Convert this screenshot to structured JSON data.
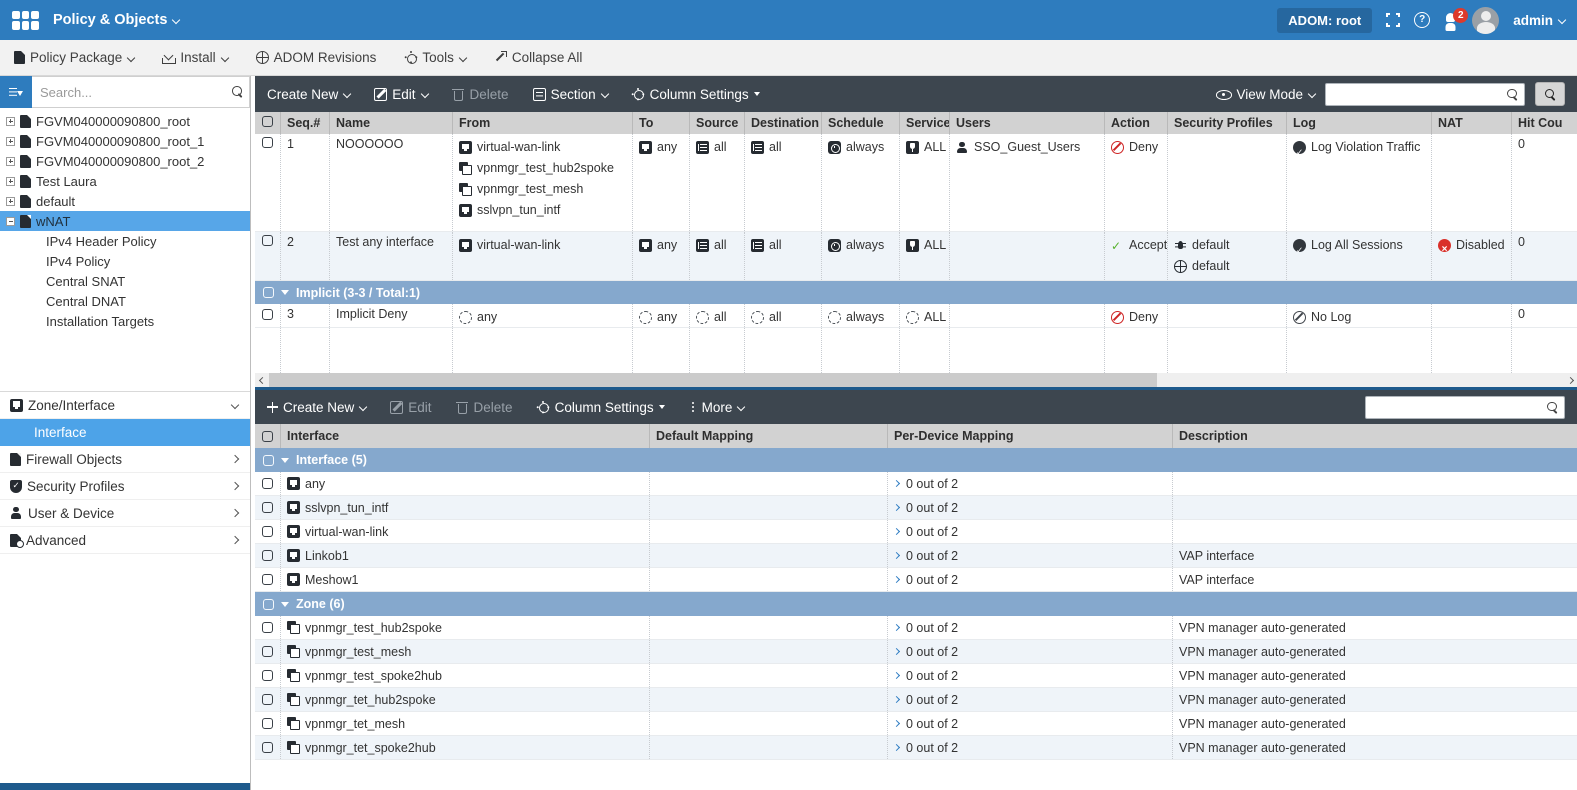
{
  "topbar": {
    "title": "Policy & Objects",
    "adom_label": "ADOM: root",
    "notification_count": "2",
    "username": "admin"
  },
  "menubar": {
    "policy_package": "Policy Package",
    "install": "Install",
    "adom_revisions": "ADOM Revisions",
    "tools": "Tools",
    "collapse_all": "Collapse All"
  },
  "sidebar": {
    "search_placeholder": "Search...",
    "tree": [
      {
        "label": "FGVM040000090800_root"
      },
      {
        "label": "FGVM040000090800_root_1"
      },
      {
        "label": "FGVM040000090800_root_2"
      },
      {
        "label": "Test Laura"
      },
      {
        "label": "default"
      },
      {
        "label": "wNAT"
      }
    ],
    "tree_children": [
      {
        "label": "IPv4 Header Policy"
      },
      {
        "label": "IPv4 Policy"
      },
      {
        "label": "Central SNAT"
      },
      {
        "label": "Central DNAT"
      },
      {
        "label": "Installation Targets"
      }
    ],
    "nav": [
      {
        "label": "Zone/Interface"
      },
      {
        "label": "Interface"
      },
      {
        "label": "Firewall Objects"
      },
      {
        "label": "Security Profiles"
      },
      {
        "label": "User & Device"
      },
      {
        "label": "Advanced"
      }
    ]
  },
  "policy_panel": {
    "toolbar": {
      "create_new": "Create New",
      "edit": "Edit",
      "delete": "Delete",
      "section": "Section",
      "column_settings": "Column Settings",
      "view_mode": "View Mode"
    },
    "columns": [
      "Seq.#",
      "Name",
      "From",
      "To",
      "Source",
      "Destination",
      "Schedule",
      "Service",
      "Users",
      "Action",
      "Security Profiles",
      "Log",
      "NAT",
      "Hit Cou"
    ],
    "rows": [
      {
        "seq": "1",
        "name": "NOOOOOO",
        "from": [
          {
            "icon": "interface-icon",
            "label": "virtual-wan-link"
          },
          {
            "icon": "zone-icon",
            "label": "vpnmgr_test_hub2spoke"
          },
          {
            "icon": "zone-icon",
            "label": "vpnmgr_test_mesh"
          },
          {
            "icon": "interface-icon",
            "label": "sslvpn_tun_intf"
          }
        ],
        "to": "any",
        "source": "all",
        "destination": "all",
        "schedule": "always",
        "service": "ALL",
        "users": "SSO_Guest_Users",
        "action": "Deny",
        "log": "Log Violation Traffic",
        "hit_count": "0"
      },
      {
        "seq": "2",
        "name": "Test any interface",
        "from": [
          {
            "icon": "interface-icon",
            "label": "virtual-wan-link"
          }
        ],
        "to": "any",
        "source": "all",
        "destination": "all",
        "schedule": "always",
        "service": "ALL",
        "action": "Accept",
        "security_profiles": [
          "default",
          "default"
        ],
        "log": "Log All Sessions",
        "nat": "Disabled",
        "hit_count": "0"
      }
    ],
    "implicit_section_label": "Implicit (3-3 / Total:1)",
    "implicit_row": {
      "seq": "3",
      "name": "Implicit Deny",
      "from": "any",
      "to": "any",
      "source": "all",
      "destination": "all",
      "schedule": "always",
      "service": "ALL",
      "action": "Deny",
      "log": "No Log",
      "hit_count": "0"
    }
  },
  "mapping_panel": {
    "toolbar": {
      "create_new": "Create New",
      "edit": "Edit",
      "delete": "Delete",
      "column_settings": "Column Settings",
      "more": "More"
    },
    "columns": [
      "Interface",
      "Default Mapping",
      "Per-Device Mapping",
      "Description"
    ],
    "sections": [
      {
        "label": "Interface (5)",
        "rows": [
          {
            "icon": "interface-icon",
            "name": "any",
            "per_device": "0 out of 2",
            "description": ""
          },
          {
            "icon": "interface-icon",
            "name": "sslvpn_tun_intf",
            "per_device": "0 out of 2",
            "description": ""
          },
          {
            "icon": "interface-icon",
            "name": "virtual-wan-link",
            "per_device": "0 out of 2",
            "description": ""
          },
          {
            "icon": "interface-icon",
            "name": "Linkob1",
            "per_device": "0 out of 2",
            "description": "VAP interface"
          },
          {
            "icon": "interface-icon",
            "name": "Meshow1",
            "per_device": "0 out of 2",
            "description": "VAP interface"
          }
        ]
      },
      {
        "label": "Zone (6)",
        "rows": [
          {
            "icon": "zone-icon",
            "name": "vpnmgr_test_hub2spoke",
            "per_device": "0 out of 2",
            "description": "VPN manager auto-generated"
          },
          {
            "icon": "zone-icon",
            "name": "vpnmgr_test_mesh",
            "per_device": "0 out of 2",
            "description": "VPN manager auto-generated"
          },
          {
            "icon": "zone-icon",
            "name": "vpnmgr_test_spoke2hub",
            "per_device": "0 out of 2",
            "description": "VPN manager auto-generated"
          },
          {
            "icon": "zone-icon",
            "name": "vpnmgr_tet_hub2spoke",
            "per_device": "0 out of 2",
            "description": "VPN manager auto-generated"
          },
          {
            "icon": "zone-icon",
            "name": "vpnmgr_tet_mesh",
            "per_device": "0 out of 2",
            "description": "VPN manager auto-generated"
          },
          {
            "icon": "zone-icon",
            "name": "vpnmgr_tet_spoke2hub",
            "per_device": "0 out of 2",
            "description": "VPN manager auto-generated"
          }
        ]
      }
    ]
  },
  "colors": {
    "topbar_blue": "#2e7cbe",
    "toolbar_dark": "#3d464f",
    "section_header_blue": "#85a8cd",
    "selection_blue": "#4da3e8",
    "badge_red": "#dd3a2c",
    "deny_red": "#ce2424",
    "accept_green": "#56b22d"
  }
}
